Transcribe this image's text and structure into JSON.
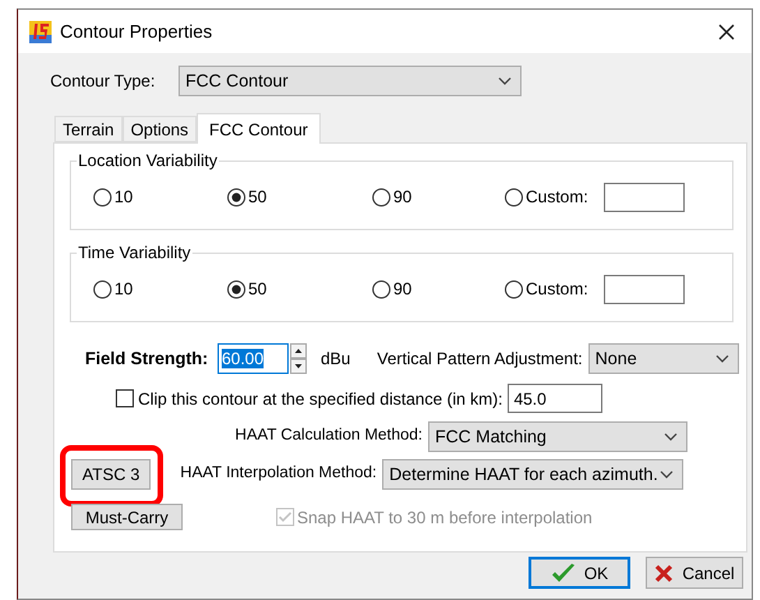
{
  "window": {
    "title": "Contour Properties"
  },
  "contour_type": {
    "label": "Contour Type:",
    "value": "FCC Contour"
  },
  "tabs": [
    {
      "label": "Terrain",
      "selected": false
    },
    {
      "label": "Options",
      "selected": false
    },
    {
      "label": "FCC Contour",
      "selected": true
    }
  ],
  "groups": [
    {
      "title": "Location Variability",
      "options": [
        {
          "kind": "radio",
          "label": "10",
          "selected": false
        },
        {
          "kind": "radio",
          "label": "50",
          "selected": true
        },
        {
          "kind": "radio",
          "label": "90",
          "selected": false
        },
        {
          "kind": "custom",
          "label": "Custom:",
          "selected": false
        }
      ]
    },
    {
      "title": "Time Variability",
      "options": [
        {
          "kind": "radio",
          "label": "10",
          "selected": false
        },
        {
          "kind": "radio",
          "label": "50",
          "selected": true
        },
        {
          "kind": "radio",
          "label": "90",
          "selected": false
        },
        {
          "kind": "custom",
          "label": "Custom:",
          "selected": false
        }
      ]
    }
  ],
  "field_strength": {
    "label": "Field Strength:",
    "value": "60.00",
    "text_selected": true,
    "unit": "dBu"
  },
  "vertical_pattern": {
    "label": "Vertical Pattern Adjustment:",
    "value": "None"
  },
  "clip": {
    "label": "Clip this contour at the specified distance (in km):",
    "checked": false,
    "value": "45.0"
  },
  "haat_calculation": {
    "label": "HAAT Calculation Method:",
    "value": "FCC Matching"
  },
  "haat_interpolation": {
    "label": "HAAT Interpolation Method:",
    "value": "Determine HAAT for each azimuth."
  },
  "side_buttons": [
    {
      "label": "ATSC 3",
      "highlighted": true
    },
    {
      "label": "Must-Carry",
      "highlighted": false
    }
  ],
  "snap": {
    "label": "Snap HAAT to 30 m before interpolation",
    "checked": true,
    "disabled": true
  },
  "buttons": [
    {
      "kind": "ok",
      "label": "OK",
      "default": true
    },
    {
      "kind": "cancel",
      "label": "Cancel",
      "default": false
    }
  ]
}
